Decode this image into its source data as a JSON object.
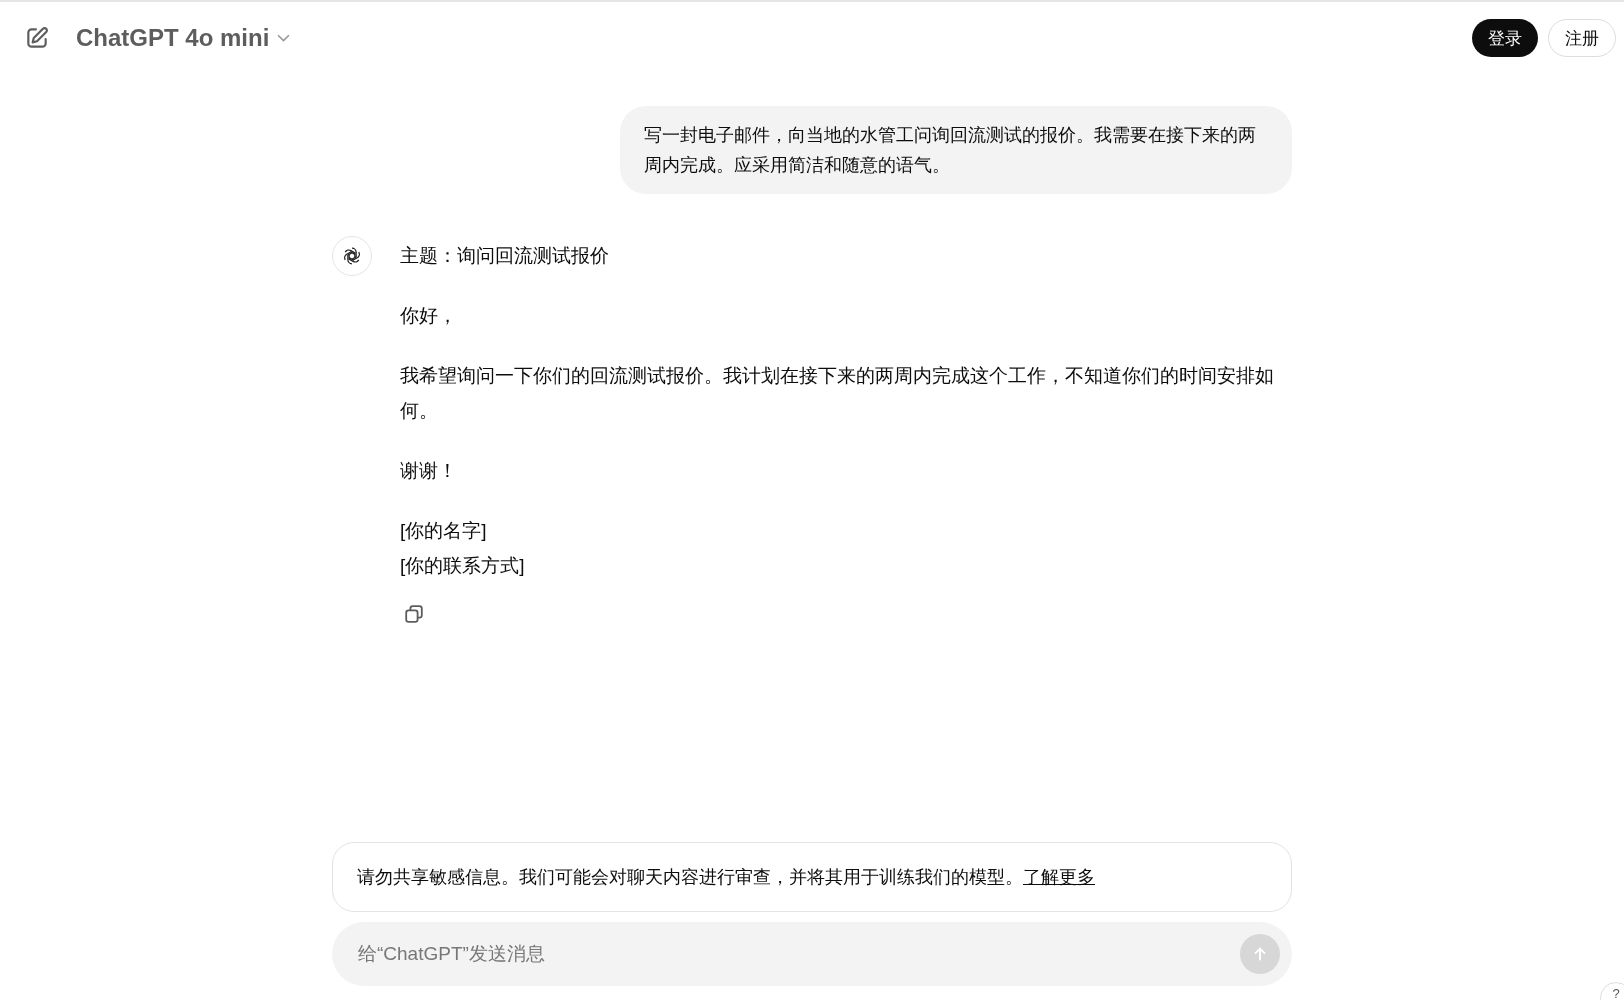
{
  "header": {
    "model": "ChatGPT 4o mini",
    "buttons": [
      {
        "label": "登录",
        "kind": "primary"
      },
      {
        "label": "注册",
        "kind": "secondary"
      }
    ]
  },
  "messages": [
    {
      "kind": "user",
      "paragraphs": [
        "写一封电子邮件，向当地的水管工问询回流测试的报价。我需要在接下来的两周内完成。应采用简洁和随意的语气。"
      ]
    },
    {
      "kind": "assistant",
      "paragraphs": [
        "主题：询问回流测试报价",
        "你好，",
        "我希望询问一下你们的回流测试报价。我计划在接下来的两周内完成这个工作，不知道你们的时间安排如何。",
        "谢谢！",
        "[你的名字]\n[你的联系方式]"
      ]
    }
  ],
  "notice": {
    "text": "请勿共享敏感信息。我们可能会对聊天内容进行审查，并将其用于训练我们的模型。",
    "link": "了解更多"
  },
  "composer": {
    "placeholder": "给“ChatGPT”发送消息",
    "send_disabled": true
  },
  "help": "?"
}
